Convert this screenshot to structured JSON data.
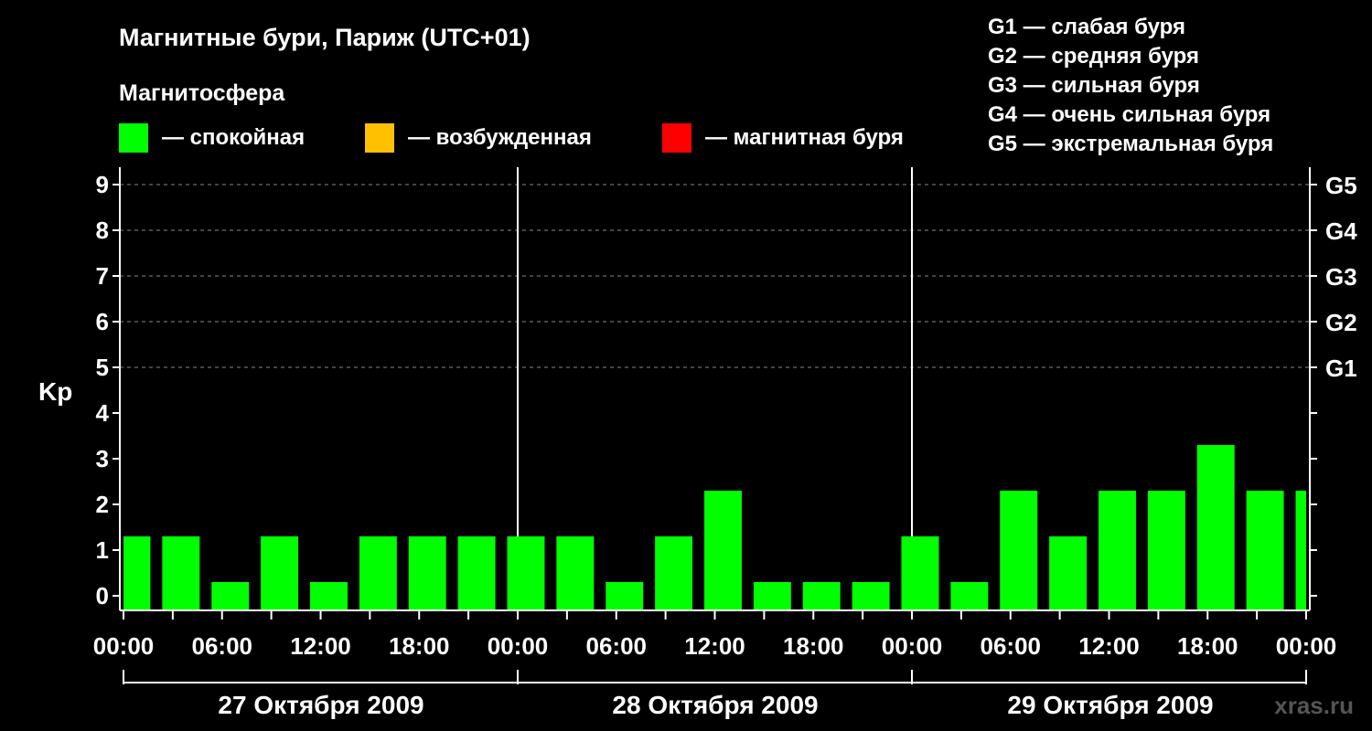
{
  "chart_data": {
    "type": "bar",
    "title": "Магнитные бури, Париж (UTC+01)",
    "legend_title": "Магнитосфера",
    "legend": [
      {
        "label": "— спокойная",
        "color": "#00ff00"
      },
      {
        "label": "— возбужденная",
        "color": "#ffc000"
      },
      {
        "label": "— магнитная буря",
        "color": "#ff0000"
      }
    ],
    "g_scale": [
      "G1 — слабая буря",
      "G2 — средняя буря",
      "G3 — сильная буря",
      "G4 — очень сильная буря",
      "G5 — экстремальная буря"
    ],
    "ylabel": "Kp",
    "ylim": [
      0,
      9
    ],
    "y_ticks": [
      "0",
      "1",
      "2",
      "3",
      "4",
      "5",
      "6",
      "7",
      "8",
      "9"
    ],
    "right_ticks": [
      {
        "value": 5,
        "label": "G1"
      },
      {
        "value": 6,
        "label": "G2"
      },
      {
        "value": 7,
        "label": "G3"
      },
      {
        "value": 8,
        "label": "G4"
      },
      {
        "value": 9,
        "label": "G5"
      }
    ],
    "x_tick_labels": [
      "00:00",
      "06:00",
      "12:00",
      "18:00",
      "00:00",
      "06:00",
      "12:00",
      "18:00",
      "00:00",
      "06:00",
      "12:00",
      "18:00",
      "00:00"
    ],
    "days": [
      "27 Октября 2009",
      "28 Октября 2009",
      "29 Октября 2009"
    ],
    "bar_color": "#00ff00",
    "values": [
      1,
      1,
      0,
      1,
      0,
      1,
      1,
      1,
      1,
      1,
      0,
      1,
      2,
      0,
      0,
      0,
      1,
      0,
      2,
      1,
      2,
      2,
      3,
      2,
      2
    ],
    "watermark": "xras.ru"
  }
}
